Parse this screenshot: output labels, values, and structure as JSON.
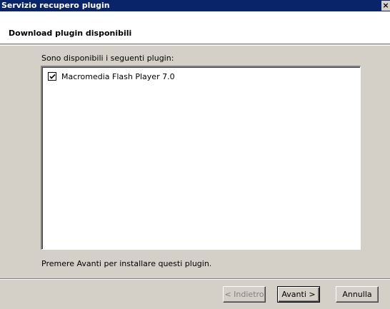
{
  "window": {
    "title": "Servizio recupero plugin",
    "close_label": "×"
  },
  "header": {
    "heading": "Download plugin disponibili"
  },
  "main": {
    "intro": "Sono disponibili i seguenti plugin:",
    "plugins": [
      {
        "label": "Macromedia Flash Player 7.0",
        "checked": true
      }
    ],
    "instruction": "Premere Avanti per installare questi plugin."
  },
  "buttons": {
    "back": "< Indietro",
    "next": "Avanti >",
    "cancel": "Annulla"
  }
}
